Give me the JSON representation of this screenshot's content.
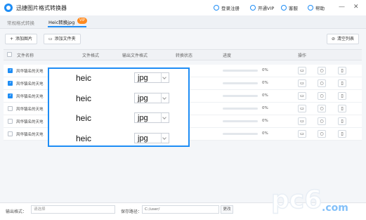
{
  "app": {
    "title": "迅捷图片格式转换器"
  },
  "titlebar": {
    "login": "登录注册",
    "vip": "开通VIP",
    "service": "客服",
    "help": "帮助"
  },
  "tabs": [
    {
      "label": "常规格式转换"
    },
    {
      "label": "Heic转换jpg"
    }
  ],
  "vip_badge": "VIP",
  "toolbar": {
    "add_image": "添加图片",
    "add_folder": "添加文件夹",
    "clear_list": "清空列表"
  },
  "table": {
    "headers": [
      "文件名称",
      "文件格式",
      "输出文件格式",
      "转换状态",
      "进度",
      "操作"
    ],
    "rows": [
      {
        "name": "风华镇名的天地",
        "checked": true,
        "progress": "0%"
      },
      {
        "name": "风华镇名的天地",
        "checked": true,
        "progress": "0%"
      },
      {
        "name": "风华镇名的天地",
        "checked": true,
        "progress": "0%"
      },
      {
        "name": "风华镇名的天地",
        "checked": false,
        "progress": "0%"
      },
      {
        "name": "风华镇名的天地",
        "checked": false,
        "progress": "0%"
      },
      {
        "name": "风华镇名的天地",
        "checked": false,
        "progress": "0%"
      }
    ]
  },
  "overlay": {
    "rows": [
      {
        "source": "heic",
        "output": "jpg"
      },
      {
        "source": "heic",
        "output": "jpg"
      },
      {
        "source": "heic",
        "output": "jpg"
      },
      {
        "source": "heic",
        "output": "jpg"
      }
    ]
  },
  "bottom": {
    "format_label": "输出格式：",
    "format_placeholder": "请选择",
    "path_label": "保存路径：",
    "path_value": "C:/user/",
    "change_label": "更改"
  },
  "watermark": {
    "text": "pc6",
    "domain": ".com"
  },
  "colors": {
    "accent": "#1e8df5",
    "vip": "#ff8a1f"
  }
}
